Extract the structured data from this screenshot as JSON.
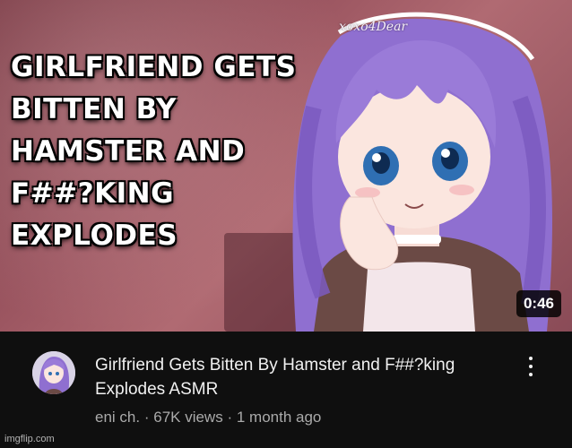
{
  "thumbnail": {
    "title_text": "GIRLFRIEND GETS\nBITTEN BY\nHAMSTER AND\nF##?KING\nEXPLODES",
    "watermark": "xoxo4Dear",
    "duration": "0:46"
  },
  "video": {
    "title": "Girlfriend Gets Bitten By Hamster and F##?king Explodes ASMR",
    "channel": "eni ch.",
    "separator": "·",
    "views": "67K views",
    "age": "1 month ago"
  },
  "watermark_site": "imgflip.com",
  "icons": {
    "menu": "more-vert-icon",
    "avatar": "channel-avatar"
  },
  "colors": {
    "background": "#0f0f0f",
    "title_text": "#f1f1f1",
    "secondary_text": "#aaaaaa",
    "hair": "#8f6fd0"
  }
}
